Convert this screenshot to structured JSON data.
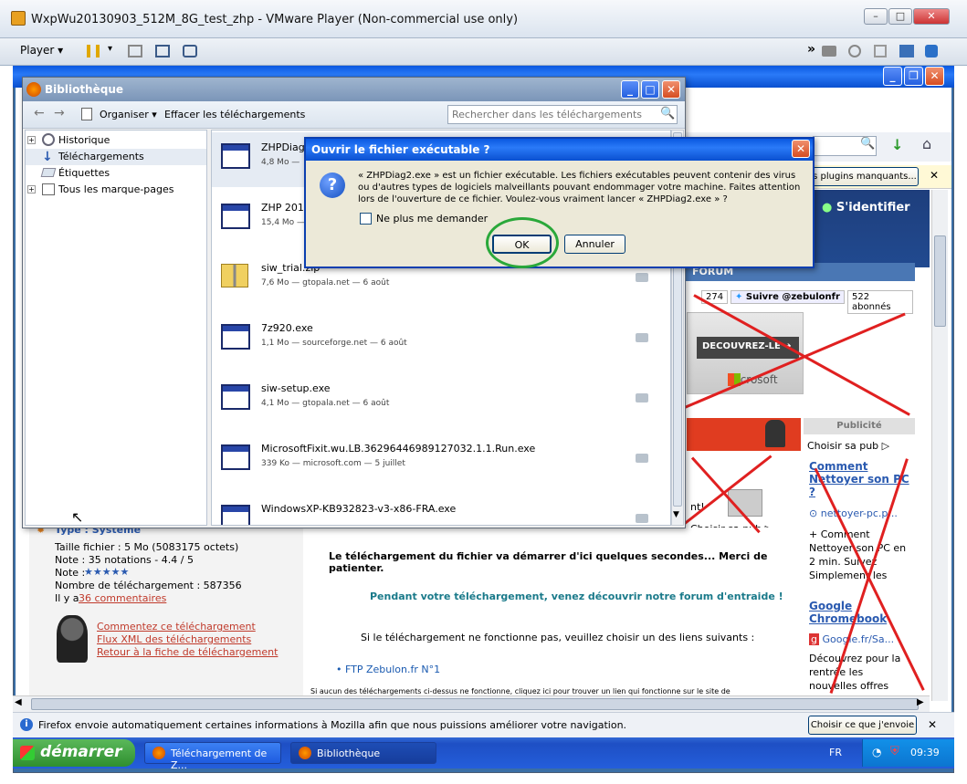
{
  "vmware": {
    "title": "WxpWu20130903_512M_8G_test_zhp - VMware Player (Non-commercial use only)",
    "menu_player": "Player",
    "btn_min": "–",
    "btn_max": "□",
    "btn_close": "✕"
  },
  "library": {
    "title": "Bibliothèque",
    "organize": "Organiser",
    "clear_downloads": "Effacer les téléchargements",
    "search_placeholder": "Rechercher dans les téléchargements",
    "tree": [
      {
        "label": "Historique"
      },
      {
        "label": "Téléchargements"
      },
      {
        "label": "Étiquettes"
      },
      {
        "label": "Tous les marque-pages"
      }
    ],
    "downloads": [
      {
        "name": "ZHPDiag2",
        "meta": "4,8 Mo —"
      },
      {
        "name": "ZHP 2013",
        "meta": "15,4 Mo —"
      },
      {
        "name": "siw_trial.zip",
        "meta": "7,6 Mo — gtopala.net — 6 août"
      },
      {
        "name": "7z920.exe",
        "meta": "1,1 Mo — sourceforge.net — 6 août"
      },
      {
        "name": "siw-setup.exe",
        "meta": "4,1 Mo — gtopala.net — 6 août"
      },
      {
        "name": "MicrosoftFixit.wu.LB.36296446989127032.1.1.Run.exe",
        "meta": "339 Ko — microsoft.com — 5 juillet"
      },
      {
        "name": "WindowsXP-KB932823-v3-x86-FRA.exe",
        "meta": ""
      }
    ]
  },
  "dialog": {
    "title": "Ouvrir le fichier exécutable ?",
    "message": "« ZHPDiag2.exe » est un fichier exécutable. Les fichiers exécutables peuvent contenir des virus ou d'autres types de logiciels malveillants pouvant endommager votre machine. Faites attention lors de l'ouverture de ce fichier. Voulez-vous vraiment lancer « ZHPDiag2.exe » ?",
    "checkbox": "Ne plus me demander",
    "ok": "OK",
    "cancel": "Annuler"
  },
  "firefox_page": {
    "plugins_button": "s plugins manquants...",
    "login": "S'identifier",
    "forum": "FORUM",
    "count_274": "274",
    "follow": "Suivre @zebulonfr",
    "subscribers": "522 abonnés",
    "ad_button": "DECOUVREZ-LE",
    "ad_brand": "Microsoft",
    "publicite": "Publicité",
    "choose_pub": "Choisir sa pub",
    "choose_pub2": "Choisir sa pub",
    "ad_link1": "Comment Nettoyer son PC ?",
    "ad_domain1": "nettoyer-pc.p...",
    "ad_text1": "+ Comment Nettoyer son PC en 2 min. Suivez Simplement les",
    "ad_link2": "Google Chromebook",
    "ad_domain2": "Google.fr/Sa...",
    "ad_text2": "Découvrez pour la rentrée les nouvelles offres",
    "ad_fragment": "nt!",
    "type_label": "Type : Système",
    "file_size": "Taille fichier : 5 Mo (5083175 octets)",
    "rating": "Note : 35 notations - 4.4 / 5",
    "note": "Note :",
    "stars": "★★★★★",
    "download_count": "Nombre de téléchargement : 587356",
    "comments_prefix": "Il y a",
    "comments_link": "36 commentaires",
    "link_comment": "Commentez ce téléchargement",
    "link_xml": "Flux XML des téléchargements",
    "link_back": "Retour à la fiche de téléchargement",
    "download_start": "Le téléchargement du fichier va démarrer d'ici quelques secondes... Merci de patienter.",
    "discover_forum": "Pendant votre téléchargement, venez découvrir notre forum d'entraide !",
    "if_fail": "Si le téléchargement ne fonctionne pas, veuillez choisir un des liens suivants :",
    "ftp": "FTP Zebulon.fr N°1",
    "footer_note": "Si aucun des téléchargements ci-dessus ne fonctionne, cliquez ici pour trouver un lien qui fonctionne sur le site de"
  },
  "firefox_status": {
    "text": "Firefox envoie automatiquement certaines informations à Mozilla afin que nous puissions améliorer votre navigation.",
    "choose": "Choisir ce que j'envoie"
  },
  "taskbar": {
    "start": "démarrer",
    "task1": "Téléchargement de Z...",
    "task2": "Bibliothèque",
    "lang": "FR",
    "clock": "09:39"
  }
}
